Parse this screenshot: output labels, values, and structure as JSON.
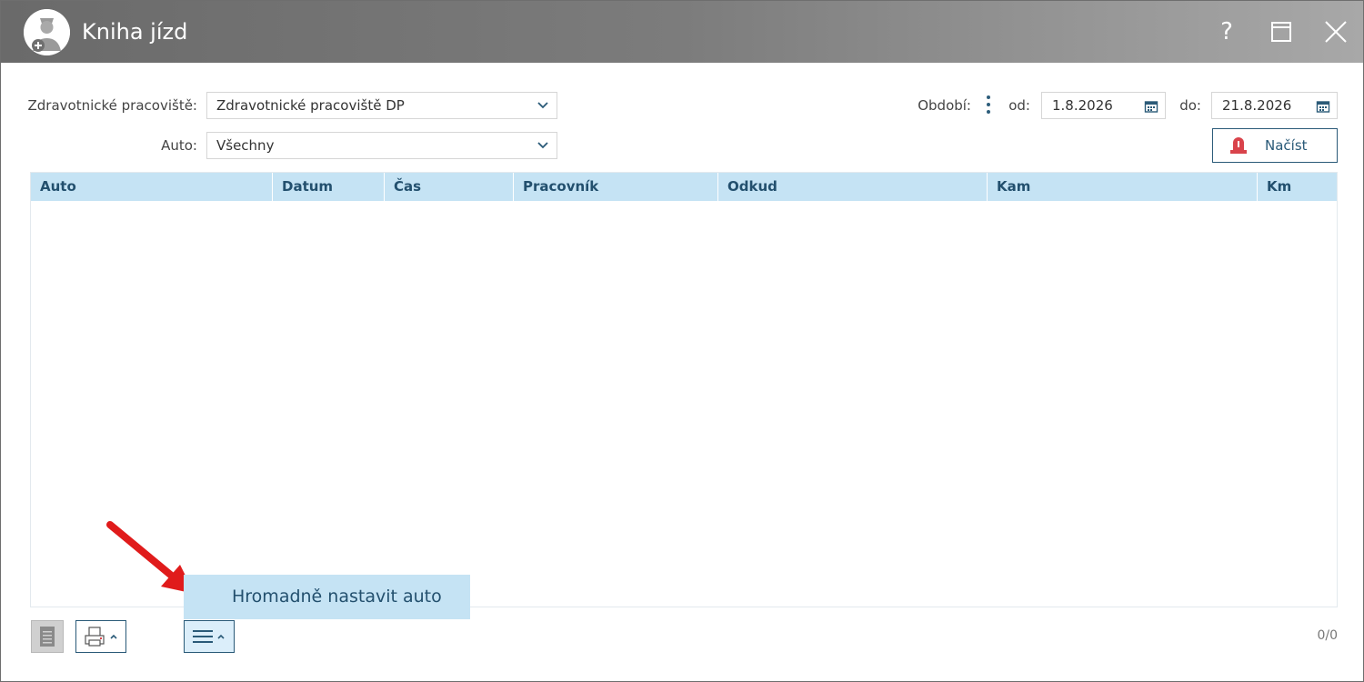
{
  "window": {
    "title": "Kniha jízd",
    "help_label": "?"
  },
  "filters": {
    "workplace_label": "Zdravotnické pracoviště:",
    "workplace_value": "Zdravotnické pracoviště DP",
    "car_label": "Auto:",
    "car_value": "Všechny",
    "period_label": "Období:",
    "from_label": "od:",
    "from_value": "1.8.2026",
    "to_label": "do:",
    "to_value": "21.8.2026",
    "load_label": "Načíst"
  },
  "table": {
    "columns": [
      "Auto",
      "Datum",
      "Čas",
      "Pracovník",
      "Odkud",
      "Kam",
      "Km"
    ],
    "rows": []
  },
  "popup": {
    "item_label": "Hromadně nastavit auto"
  },
  "footer": {
    "record_count": "0/0"
  },
  "colors": {
    "accent": "#2a5a78",
    "header_bg": "#c5e3f4",
    "arrow": "#e01b1b"
  },
  "icons": {
    "app": "nurse-avatar-icon",
    "doc": "document-icon",
    "print": "printer-icon",
    "menu": "hamburger-menu-icon",
    "load": "siren-icon"
  }
}
